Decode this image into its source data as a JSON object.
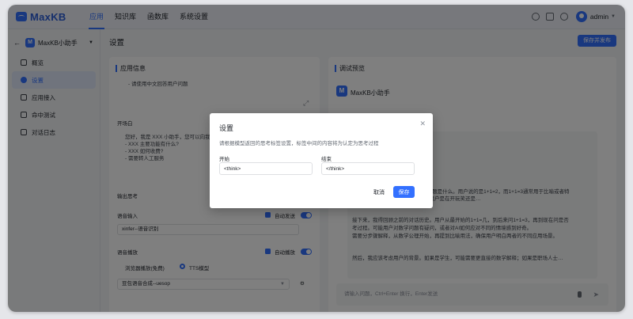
{
  "header": {
    "brand": "MaxKB",
    "nav": [
      "应用",
      "知识库",
      "函数库",
      "系统设置"
    ],
    "user": "admin"
  },
  "sidebar": {
    "app_badge": "M",
    "app_name": "MaxKB小助手",
    "items": [
      "概览",
      "设置",
      "应用接入",
      "命中测试",
      "对话日志"
    ]
  },
  "main": {
    "title": "设置",
    "publish_label": "保存并发布",
    "left_panel": {
      "heading": "应用信息",
      "question_lines": [
        "- 请使用中文回答用户问题"
      ],
      "opening_label": "开场白",
      "opening_lines": [
        "您好，我是 XXX 小助手，您可以向我提出…",
        "- XXX  主要功能有什么?",
        "- XXX  如何收费?",
        "- 需要转人工服务"
      ],
      "output_think_label": "输出思考",
      "voice_input_label": "语音输入",
      "auto_send_label": "自动发送",
      "stt_model": "xinfer--语音识别",
      "voice_play_label": "语音播放",
      "auto_play_label": "自动播放",
      "browser_play_label": "浏览器播放(免费)",
      "tts_label": "TTS模型",
      "tts_model": "豆包语音合成--uesop"
    },
    "right_panel": {
      "heading": "调试预览",
      "chat_badge": "M",
      "chat_title": "MaxKB小助手",
      "bubble_lines": [
        "等于3。首先，我需要确认用户的问题是什么。用户说的是1+1=2，而1+1=3通常用于比喻或者特",
        "殊情况，我需要结合上下文来判断用户是在开玩笑还是…",
        "",
        "接下来，我得回顾之前的对话历史。用户从最开始的1+1=几，到后来问1+1=3，再到现在问是否",
        "考过程。可能用户对数学问题有疑问，或者对AI如何应对不同的情境感到好奇。",
        "需要分步骤解释，从数学公理开始，再提到比喻用法，确保用户明白两者的不同应用场景。",
        "然后，我应该考虑用户的背景。如果是学生，可能需要更直接的数学解释；如果是职场人士…"
      ],
      "input_placeholder": "请输入问题，Ctrl+Enter 换行，Enter发送"
    }
  },
  "dialog": {
    "title": "设置",
    "description": "请根据模型返回的思考标签设置，标签中间的内容将为认定为思考过程",
    "start_label": "开始",
    "start_value": "<think>",
    "end_label": "结束",
    "end_value": "</think>",
    "cancel_label": "取消",
    "save_label": "保存"
  },
  "colors": {
    "primary": "#3370ff",
    "overlay": "rgba(0,0,0,0.5)"
  }
}
